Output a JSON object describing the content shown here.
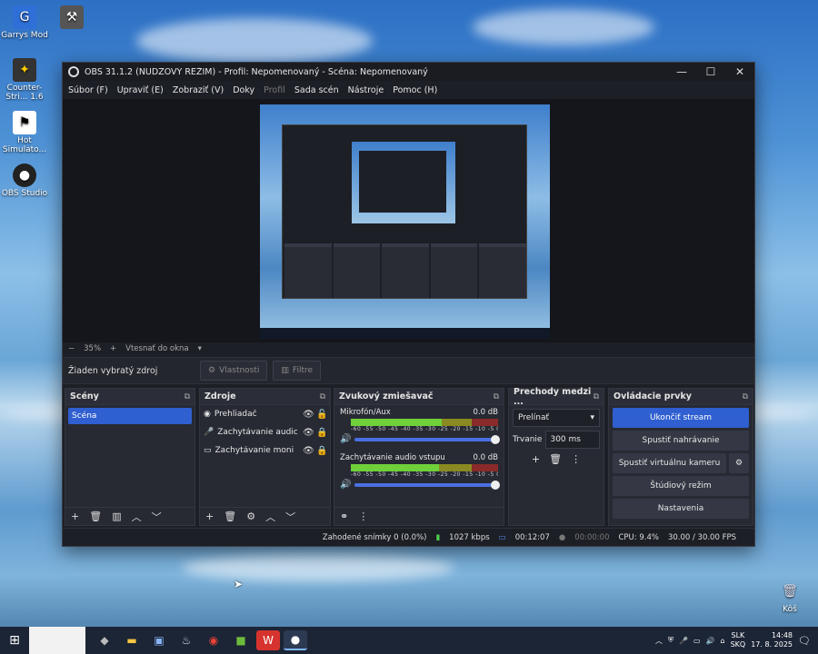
{
  "desktop": {
    "icons": [
      {
        "label": "Garrys Mod",
        "glyph": "G"
      },
      {
        "label": "",
        "glyph": "⚒"
      },
      {
        "label": "Counter-Stri... 1.6",
        "glyph": "✦"
      },
      {
        "label": "Hot Simulato...",
        "glyph": "⚑"
      },
      {
        "label": "OBS Studio",
        "glyph": "●"
      },
      {
        "label": "Kôš",
        "glyph": "🗑"
      }
    ]
  },
  "obs": {
    "title": "OBS 31.1.2 (NÚDZOVÝ REŽIM) - Profil: Nepomenovaný - Scéna: Nepomenovaný",
    "window_controls": {
      "minimize": "—",
      "maximize": "☐",
      "close": "✕"
    },
    "menu": [
      {
        "label": "Súbor (F)",
        "disabled": false
      },
      {
        "label": "Upraviť (E)",
        "disabled": false
      },
      {
        "label": "Zobraziť (V)",
        "disabled": false
      },
      {
        "label": "Doky",
        "disabled": false
      },
      {
        "label": "Profil",
        "disabled": true
      },
      {
        "label": "Sada scén",
        "disabled": false
      },
      {
        "label": "Nástroje",
        "disabled": false
      },
      {
        "label": "Pomoc (H)",
        "disabled": false
      }
    ],
    "zoom": {
      "minus": "−",
      "value": "35%",
      "plus": "+",
      "fit": "Vtesnať do okna",
      "arrow": "▾"
    },
    "source_toolbar": {
      "no_source": "Žiaden vybratý zdroj",
      "properties": "Vlastnosti",
      "filters": "Filtre"
    },
    "docks": {
      "scenes": {
        "title": "Scény",
        "items": [
          "Scéna"
        ]
      },
      "sources": {
        "title": "Zdroje",
        "items": [
          {
            "label": "Prehliadač",
            "icon": "◉"
          },
          {
            "label": "Zachytávanie audic",
            "icon": "🎤"
          },
          {
            "label": "Zachytávanie moni",
            "icon": "▭"
          }
        ]
      },
      "mixer": {
        "title": "Zvukový zmiešavač",
        "channels": [
          {
            "name": "Mikrofón/Aux",
            "db": "0.0 dB",
            "level": 0.62
          },
          {
            "name": "Zachytávanie audio vstupu",
            "db": "0.0 dB",
            "level": 0.6
          }
        ],
        "scale": "-60 -55 -50 -45 -40 -35 -30 -25 -20 -15 -10 -5 0"
      },
      "transitions": {
        "title": "Prechody medzi ...",
        "selected": "Prelínať",
        "duration_label": "Trvanie",
        "duration_value": "300 ms"
      },
      "controls": {
        "title": "Ovládacie prvky",
        "buttons": [
          "Ukončiť stream",
          "Spustiť nahrávanie",
          "Spustiť virtuálnu kameru",
          "Štúdiový režim",
          "Nastavenia"
        ]
      }
    },
    "status": {
      "dropped": "Zahodené snímky 0 (0.0%)",
      "bitrate": "1027 kbps",
      "stream_time": "00:12:07",
      "rec_time": "00:00:00",
      "cpu": "CPU: 9.4%",
      "fps": "30.00 / 30.00 FPS"
    }
  },
  "taskbar": {
    "lang": [
      "SLK",
      "SKQ"
    ],
    "time": "14:48",
    "date": "17. 8. 2025"
  }
}
